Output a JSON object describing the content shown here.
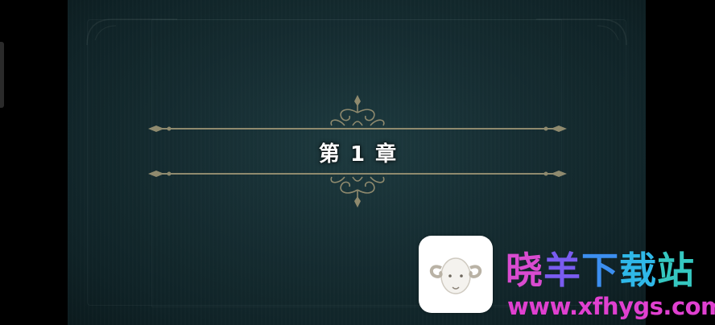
{
  "chapter": {
    "title": "第 1 章"
  },
  "watermark": {
    "site_name": [
      "晓",
      "羊",
      "下",
      "载",
      "站"
    ],
    "url": "www.xfhygs.com",
    "logo_icon": "ram-head-icon"
  },
  "colors": {
    "background": "#152c31",
    "ornament": "#8f8a6e",
    "title_text": "#ffffff"
  }
}
